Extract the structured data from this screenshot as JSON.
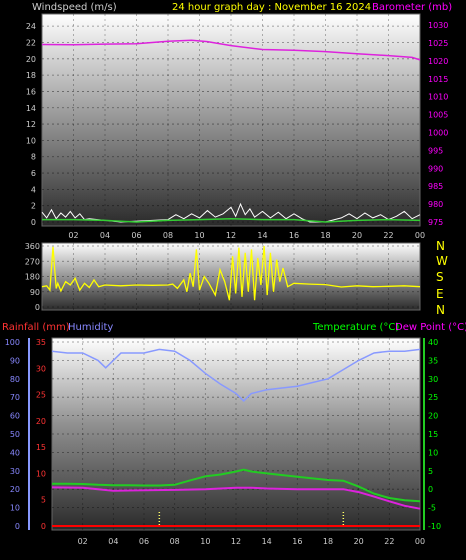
{
  "colors": {
    "windspeed_label": "#cccccc",
    "title": "#ffff00",
    "barometer_label": "#ff00ff",
    "barometer_line": "#dd22dd",
    "wind_gust": "#ffffff",
    "wind_avg": "#33cc33",
    "direction_line": "#ffff00",
    "compass": "#ffff00",
    "rainfall_label": "#ff3333",
    "rain_line": "#ff0000",
    "humidity_label": "#8888ff",
    "humidity_line": "#8899ff",
    "temperature_label": "#00ff00",
    "temperature_line": "#22cc22",
    "dewpoint_label": "#ff00ff",
    "dewpoint_line": "#dd22dd",
    "tick_dotted": "#ffff66",
    "axis_text": "#cccccc"
  },
  "header": {
    "windspeed": "Windspeed (m/s)",
    "title": "24 hour graph day : November 16 2024",
    "barometer": "Barometer (mb)"
  },
  "mid_header": {
    "rainfall": "Rainfall (mm)",
    "humidity": "Humidity",
    "temperature": "Temperature (°C)",
    "dewpoint": "Dew Point (°C)"
  },
  "compass": [
    "N",
    "W",
    "S",
    "E",
    "N"
  ],
  "chart_data": [
    {
      "type": "line",
      "name": "wind-barometer",
      "x_ticks": [
        "02",
        "04",
        "06",
        "08",
        "10",
        "12",
        "14",
        "16",
        "18",
        "20",
        "22",
        "00"
      ],
      "y_left": {
        "label": "Windspeed (m/s)",
        "ticks": [
          0,
          2,
          4,
          6,
          8,
          10,
          12,
          14,
          16,
          18,
          20,
          22,
          24
        ],
        "ylim": [
          0,
          25
        ]
      },
      "y_right": {
        "label": "Barometer (mb)",
        "ticks": [
          975,
          980,
          985,
          990,
          995,
          1000,
          1005,
          1010,
          1015,
          1020,
          1025,
          1030
        ],
        "ylim": [
          975,
          1032
        ]
      },
      "series": [
        {
          "name": "Barometer",
          "axis": "right",
          "x": [
            0,
            2,
            4,
            6,
            8,
            9.5,
            10.5,
            12,
            14,
            16,
            18,
            20,
            22,
            23.5,
            24
          ],
          "values": [
            1024.6,
            1024.5,
            1024.7,
            1024.8,
            1025.5,
            1025.8,
            1025.4,
            1024.3,
            1023.2,
            1023,
            1022.6,
            1022,
            1021.5,
            1021,
            1020.3
          ]
        },
        {
          "name": "Wind gust",
          "axis": "left",
          "x": [
            0,
            0.3,
            0.6,
            0.9,
            1.2,
            1.5,
            1.8,
            2.1,
            2.4,
            2.7,
            3,
            5,
            8,
            8.5,
            9,
            9.5,
            10,
            10.5,
            11,
            11.5,
            12,
            12.3,
            12.6,
            12.9,
            13.2,
            13.5,
            14,
            14.5,
            15,
            15.5,
            16,
            16.5,
            17,
            18,
            19,
            19.5,
            20,
            20.5,
            21,
            21.5,
            22,
            22.5,
            23,
            23.5,
            24
          ],
          "values": [
            1.2,
            0.5,
            1.5,
            0.4,
            1.1,
            0.6,
            1.3,
            0.5,
            1,
            0.3,
            0.4,
            0,
            0.3,
            0.9,
            0.4,
            1,
            0.5,
            1.4,
            0.6,
            1,
            1.8,
            0.7,
            2.2,
            0.9,
            1.6,
            0.6,
            1.3,
            0.5,
            1.2,
            0.4,
            1,
            0.4,
            0,
            0,
            0.5,
            1,
            0.4,
            1.1,
            0.5,
            0.9,
            0.3,
            0.7,
            1.3,
            0.4,
            0.9
          ]
        },
        {
          "name": "Wind average",
          "axis": "left",
          "x": [
            0,
            2,
            4,
            6,
            8,
            10,
            12,
            14,
            16,
            18,
            20,
            22,
            24
          ],
          "values": [
            0.3,
            0.3,
            0.2,
            0,
            0.2,
            0.3,
            0.4,
            0.3,
            0.3,
            0,
            0.2,
            0.3,
            0.2
          ]
        }
      ]
    },
    {
      "type": "line",
      "name": "wind-direction",
      "x_ticks": [
        "02",
        "04",
        "06",
        "08",
        "10",
        "12",
        "14",
        "16",
        "18",
        "20",
        "22",
        "00"
      ],
      "y_left": {
        "ticks": [
          0,
          90,
          180,
          270,
          360
        ],
        "ylim": [
          0,
          360
        ]
      },
      "series": [
        {
          "name": "Wind direction",
          "x": [
            0,
            0.3,
            0.5,
            0.7,
            0.9,
            1,
            1.2,
            1.5,
            1.8,
            2.1,
            2.4,
            2.7,
            3,
            3.3,
            3.6,
            4,
            5,
            6,
            7,
            8,
            8.3,
            8.6,
            9,
            9.2,
            9.4,
            9.6,
            9.8,
            10,
            10.3,
            10.6,
            11,
            11.3,
            11.6,
            11.9,
            12.1,
            12.3,
            12.5,
            12.7,
            12.9,
            13.1,
            13.3,
            13.5,
            13.7,
            13.9,
            14.1,
            14.3,
            14.5,
            14.7,
            14.9,
            15.1,
            15.3,
            15.6,
            16,
            17,
            18,
            19,
            20,
            21,
            22,
            23,
            24
          ],
          "values": [
            120,
            125,
            100,
            355,
            110,
            140,
            95,
            150,
            130,
            170,
            100,
            140,
            115,
            160,
            120,
            130,
            125,
            130,
            128,
            130,
            135,
            110,
            160,
            90,
            200,
            120,
            340,
            100,
            180,
            140,
            70,
            220,
            150,
            40,
            300,
            80,
            350,
            60,
            320,
            90,
            340,
            40,
            290,
            130,
            360,
            70,
            320,
            90,
            280,
            150,
            230,
            120,
            140,
            135,
            132,
            118,
            125,
            120,
            122,
            125,
            120
          ]
        }
      ]
    },
    {
      "type": "line",
      "name": "temp-humidity",
      "x_ticks": [
        "02",
        "04",
        "06",
        "08",
        "10",
        "12",
        "14",
        "16",
        "18",
        "20",
        "22",
        "00"
      ],
      "y_left": {
        "label": "Rainfall (mm)",
        "ticks": [
          0,
          5,
          10,
          15,
          20,
          25,
          30,
          35
        ],
        "ylim": [
          0,
          35
        ]
      },
      "y_left2": {
        "label": "Humidity",
        "ticks": [
          0,
          10,
          20,
          30,
          40,
          50,
          60,
          70,
          80,
          90,
          100
        ],
        "ylim": [
          0,
          100
        ]
      },
      "y_right": {
        "label": "Temperature (°C)",
        "ticks": [
          -10,
          -5,
          0,
          5,
          10,
          15,
          20,
          25,
          30,
          35,
          40
        ],
        "ylim": [
          -10,
          40
        ]
      },
      "series": [
        {
          "name": "Humidity",
          "axis": "left2",
          "x": [
            0,
            1,
            2,
            3,
            3.5,
            4.5,
            6,
            7,
            8,
            9,
            10,
            11,
            12,
            12.5,
            13,
            14,
            16,
            18,
            19,
            20,
            21,
            22,
            23,
            24
          ],
          "values": [
            95,
            94,
            94,
            90,
            86,
            94,
            94,
            96,
            95,
            90,
            83,
            77,
            72,
            68,
            72,
            74,
            76,
            80,
            85,
            90,
            94,
            95,
            95,
            96
          ]
        },
        {
          "name": "Temperature",
          "axis": "right",
          "x": [
            0,
            1,
            2,
            3,
            4,
            5,
            6,
            7,
            8,
            9,
            10,
            11,
            12,
            12.5,
            13,
            14,
            16,
            18,
            19,
            20,
            21,
            22,
            23,
            24
          ],
          "values": [
            1.5,
            1.5,
            1.4,
            1.2,
            1.1,
            1.1,
            1,
            1,
            1.2,
            2.4,
            3.5,
            4,
            4.8,
            5.3,
            4.8,
            4.3,
            3.4,
            2.5,
            2.3,
            0.7,
            -1.2,
            -2.4,
            -3,
            -3.3
          ]
        },
        {
          "name": "Dew Point",
          "axis": "right",
          "x": [
            0,
            2,
            4,
            6,
            8,
            10,
            12,
            13,
            14,
            16,
            18,
            19,
            20,
            21,
            22,
            23,
            24
          ],
          "values": [
            0.5,
            0.4,
            -0.4,
            -0.3,
            -0.2,
            0,
            0.4,
            0.4,
            0.2,
            0,
            0,
            0,
            -0.8,
            -2,
            -3.3,
            -4.5,
            -5.3
          ]
        },
        {
          "name": "Rainfall",
          "axis": "left",
          "x": [
            0,
            24
          ],
          "values": [
            0,
            0
          ]
        }
      ],
      "markers_x": [
        7,
        19
      ]
    }
  ]
}
